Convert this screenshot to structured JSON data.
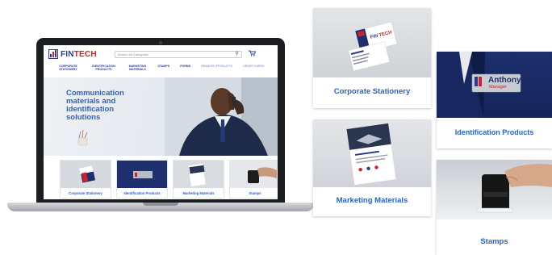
{
  "site": {
    "logo_text_main": "FIN",
    "logo_text_accent": "TECH",
    "search_placeholder": "Search All Categories",
    "nav": [
      "Corporate Stationery",
      "Identification Products",
      "Marketing Materials",
      "Stamps",
      "Forms",
      "Branded Products",
      "Order Cards"
    ],
    "hero_title": "Communication materials and identification solutions",
    "categories": [
      "Corporate Stationery",
      "Identification Products",
      "Marketing Materials",
      "Stamps"
    ]
  },
  "cards": {
    "corporate": "Corporate Stationery",
    "identification": "Identification Products",
    "marketing": "Marketing Materials",
    "stamps": "Stamps"
  },
  "badge": {
    "name": "Anthony",
    "role": "Manager"
  },
  "colors": {
    "brand_blue": "#2b3a8c",
    "link_blue": "#2b62c7",
    "brand_red": "#d11f2a"
  },
  "icons": [
    "search-icon",
    "cart-icon",
    "logo-icon"
  ]
}
